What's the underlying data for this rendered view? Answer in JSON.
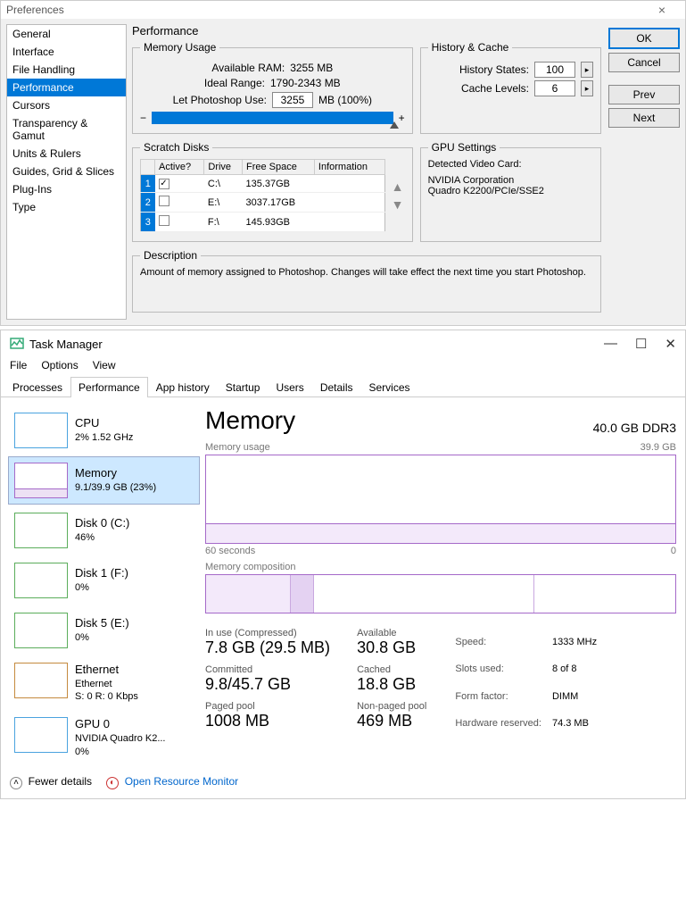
{
  "prefs": {
    "title": "Preferences",
    "sidebar": [
      "General",
      "Interface",
      "File Handling",
      "Performance",
      "Cursors",
      "Transparency & Gamut",
      "Units & Rulers",
      "Guides, Grid & Slices",
      "Plug-Ins",
      "Type"
    ],
    "selected": "Performance",
    "section": "Performance",
    "buttons": {
      "ok": "OK",
      "cancel": "Cancel",
      "prev": "Prev",
      "next": "Next"
    },
    "mem": {
      "legend": "Memory Usage",
      "avail_label": "Available RAM:",
      "avail_val": "3255 MB",
      "ideal_label": "Ideal Range:",
      "ideal_val": "1790-2343 MB",
      "let_label": "Let Photoshop Use:",
      "let_val": "3255",
      "let_unit": "MB (100%)"
    },
    "hist": {
      "legend": "History & Cache",
      "states_label": "History States:",
      "states_val": "100",
      "cache_label": "Cache Levels:",
      "cache_val": "6"
    },
    "scratch": {
      "legend": "Scratch Disks",
      "headers": [
        "",
        "Active?",
        "Drive",
        "Free Space",
        "Information"
      ],
      "rows": [
        {
          "idx": "1",
          "active": true,
          "drive": "C:\\",
          "free": "135.37GB"
        },
        {
          "idx": "2",
          "active": false,
          "drive": "E:\\",
          "free": "3037.17GB"
        },
        {
          "idx": "3",
          "active": false,
          "drive": "F:\\",
          "free": "145.93GB"
        }
      ]
    },
    "gpu": {
      "legend": "GPU Settings",
      "detected": "Detected Video Card:",
      "vendor": "NVIDIA Corporation",
      "card": "Quadro K2200/PCIe/SSE2"
    },
    "desc": {
      "legend": "Description",
      "text": "Amount of memory assigned to Photoshop. Changes will take effect the next time you start Photoshop."
    }
  },
  "tm": {
    "title": "Task Manager",
    "menu": [
      "File",
      "Options",
      "View"
    ],
    "tabs": [
      "Processes",
      "Performance",
      "App history",
      "Startup",
      "Users",
      "Details",
      "Services"
    ],
    "selected_tab": "Performance",
    "resources": [
      {
        "title": "CPU",
        "sub": "2%  1.52 GHz",
        "color": "#4aa3df"
      },
      {
        "title": "Memory",
        "sub": "9.1/39.9 GB (23%)",
        "color": "#a569c9",
        "selected": true
      },
      {
        "title": "Disk 0 (C:)",
        "sub": "46%",
        "color": "#5bad5b"
      },
      {
        "title": "Disk 1 (F:)",
        "sub": "0%",
        "color": "#5bad5b"
      },
      {
        "title": "Disk 5 (E:)",
        "sub": "0%",
        "color": "#5bad5b"
      },
      {
        "title": "Ethernet",
        "sub": "Ethernet",
        "sub2": "S: 0  R: 0 Kbps",
        "color": "#c58a3e"
      },
      {
        "title": "GPU 0",
        "sub": "NVIDIA Quadro K2...",
        "sub2": "0%",
        "color": "#4aa3df"
      }
    ],
    "detail": {
      "heading": "Memory",
      "capacity": "40.0 GB DDR3",
      "usage_label": "Memory usage",
      "usage_max": "39.9 GB",
      "axis_left": "60 seconds",
      "axis_right": "0",
      "comp_label": "Memory composition",
      "stats": {
        "inuse_label": "In use (Compressed)",
        "inuse": "7.8 GB (29.5 MB)",
        "avail_label": "Available",
        "avail": "30.8 GB",
        "committed_label": "Committed",
        "committed": "9.8/45.7 GB",
        "cached_label": "Cached",
        "cached": "18.8 GB",
        "paged_label": "Paged pool",
        "paged": "1008 MB",
        "nonpaged_label": "Non-paged pool",
        "nonpaged": "469 MB"
      },
      "specs": {
        "speed_l": "Speed:",
        "speed": "1333 MHz",
        "slots_l": "Slots used:",
        "slots": "8 of 8",
        "form_l": "Form factor:",
        "form": "DIMM",
        "hw_l": "Hardware reserved:",
        "hw": "74.3 MB"
      }
    },
    "footer": {
      "fewer": "Fewer details",
      "orm": "Open Resource Monitor"
    }
  },
  "chart_data": {
    "type": "line",
    "title": "Memory usage",
    "x": [
      60,
      0
    ],
    "xlabel": "seconds",
    "ylim": [
      0,
      39.9
    ],
    "yunit": "GB",
    "series": [
      {
        "name": "Memory",
        "values_approx_gb": 9.1,
        "flat": true
      }
    ]
  }
}
